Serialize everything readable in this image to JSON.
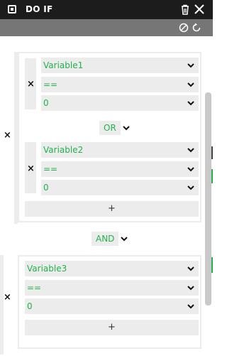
{
  "window": {
    "title": "DO IF"
  },
  "group1": {
    "conditions": [
      {
        "variable": "Variable1",
        "operator": "==",
        "value": "0"
      },
      {
        "variable": "Variable2",
        "operator": "==",
        "value": "0"
      }
    ],
    "joiner": "OR",
    "add_label": "+"
  },
  "outer_joiner": "AND",
  "group2": {
    "conditions": [
      {
        "variable": "Variable3",
        "operator": "==",
        "value": "0"
      }
    ],
    "add_label": "+"
  },
  "remove_label": "×",
  "colors": {
    "accent": "#22b14c",
    "titlebar": "#1c1c1c",
    "toolbar": "#767676",
    "field_bg": "#ececec"
  },
  "icons": [
    "node-icon",
    "trash-icon",
    "close-icon",
    "disable-icon",
    "reset-icon",
    "chevron-down-icon"
  ]
}
